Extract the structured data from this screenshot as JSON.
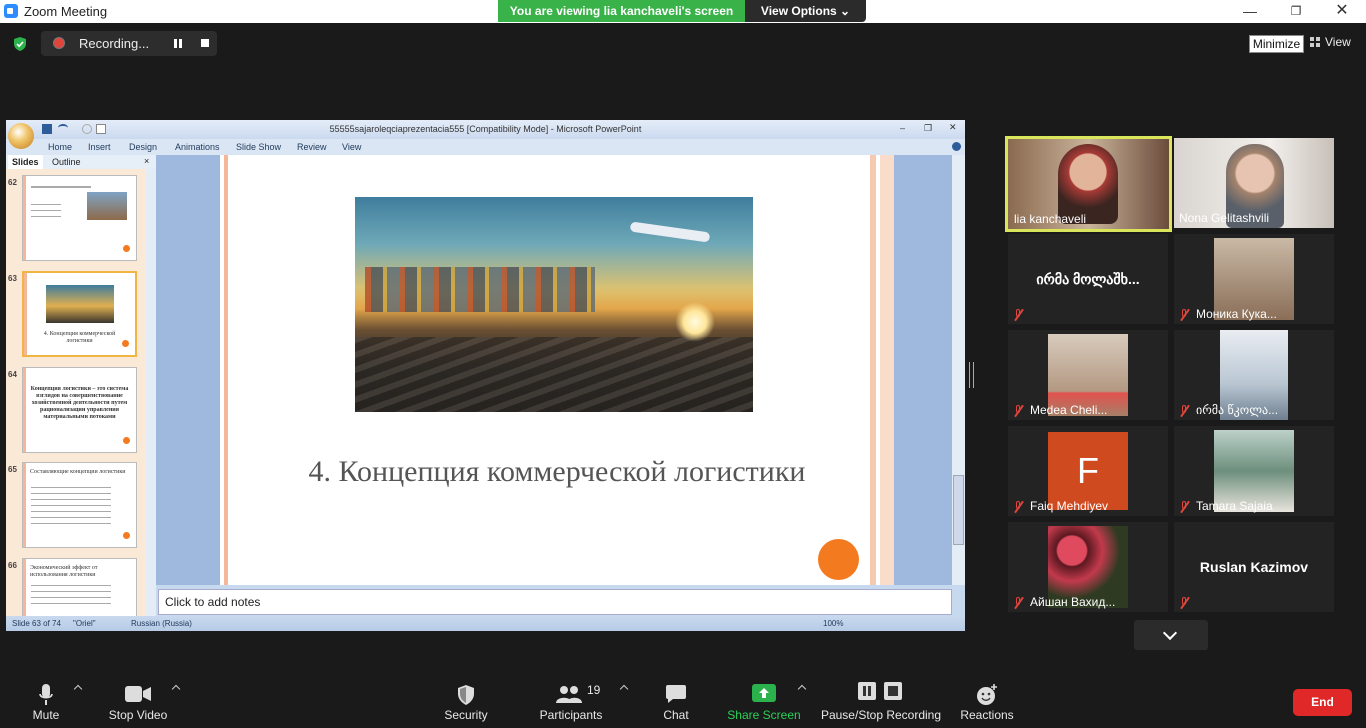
{
  "window": {
    "title": "Zoom Meeting"
  },
  "banner": {
    "viewing": "You are viewing lia kanchaveli's screen",
    "view_options": "View Options"
  },
  "recording": {
    "label": "Recording..."
  },
  "top_right": {
    "minimize_tip": "Minimize",
    "view_label": "View"
  },
  "ppt": {
    "doc_title": "55555sajaroleqciaprezentacia555 [Compatibility Mode] - Microsoft PowerPoint",
    "tabs": [
      "Home",
      "Insert",
      "Design",
      "Animations",
      "Slide Show",
      "Review",
      "View"
    ],
    "panel_tabs": [
      "Slides",
      "Outline"
    ],
    "thumbs": [
      {
        "num": "62",
        "text": ""
      },
      {
        "num": "63",
        "text": "4. Концепция коммерческой логистики"
      },
      {
        "num": "64",
        "text": "Концепция логистики – это система взглядов на совершенствование хозяйственной деятельности путем рационализации управления материальными потоками"
      },
      {
        "num": "65",
        "text": "Составляющие концепции логистики"
      },
      {
        "num": "66",
        "text": "Экономический эффект от использования логистики"
      }
    ],
    "slide_heading": "4. Концепция коммерческой логистики",
    "notes_placeholder": "Click to add notes",
    "status": {
      "slide": "Slide 63 of 74",
      "theme": "\"Oriel\"",
      "language": "Russian (Russia)",
      "zoom": "100%"
    }
  },
  "participants": [
    {
      "name": "lia kanchaveli",
      "muted": false,
      "video": true,
      "active": true
    },
    {
      "name": "Nona Gelitashvili",
      "muted": false,
      "video": true,
      "active": false
    },
    {
      "name": "ირმა მოლაშხ...",
      "muted": true,
      "video": false,
      "active": false
    },
    {
      "name": "Моника Кука...",
      "muted": true,
      "video": true,
      "active": false
    },
    {
      "name": "Medea Cheli...",
      "muted": true,
      "video": true,
      "active": false
    },
    {
      "name": "ირმა წკოლა...",
      "muted": true,
      "video": true,
      "active": false
    },
    {
      "name": "Faiq Mehdiyev",
      "muted": true,
      "video": false,
      "avatar_letter": "F",
      "active": false
    },
    {
      "name": "Tamara Sajaia",
      "muted": true,
      "video": true,
      "active": false
    },
    {
      "name": "Айшан Вахид...",
      "muted": true,
      "video": true,
      "active": false
    },
    {
      "name": "Ruslan Kazimov",
      "muted": true,
      "video": false,
      "active": false
    }
  ],
  "toolbar": {
    "mute": "Mute",
    "stop_video": "Stop Video",
    "security": "Security",
    "participants": "Participants",
    "participants_count": "19",
    "chat": "Chat",
    "share_screen": "Share Screen",
    "pause_stop_recording": "Pause/Stop Recording",
    "reactions": "Reactions",
    "end": "End"
  },
  "colors": {
    "accent_green": "#3ab24a",
    "end_red": "#e02828",
    "active_speaker": "#d9e55b",
    "slide_dot": "#f47a20"
  }
}
